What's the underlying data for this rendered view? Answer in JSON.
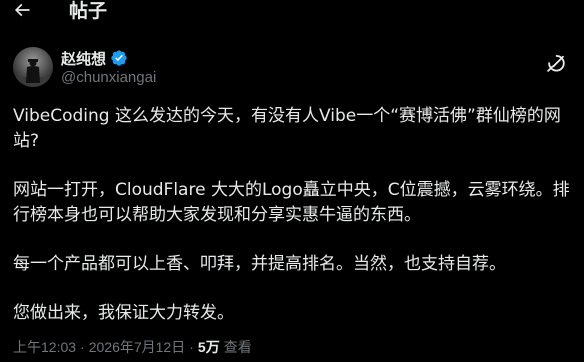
{
  "header": {
    "title": "帖子"
  },
  "author": {
    "display_name": "赵纯想",
    "handle": "@chunxiangai",
    "verified": true,
    "verified_color": "#1d9bf0"
  },
  "post": {
    "paragraphs": [
      "VibeCoding 这么发达的今天，有没有人Vibe一个“赛博活佛”群仙榜的网站?",
      "网站一打开，CloudFlare 大大的Logo矗立中央，C位震撼，云雾环绕。排行榜本身也可以帮助大家发现和分享实惠牛逼的东西。",
      "每一个产品都可以上香、叩拜，并提高排名。当然，也支持自荐。",
      "您做出来，我保证大力转发。"
    ]
  },
  "meta": {
    "time": "上午12:03",
    "separator": "·",
    "date": "2026年7月12日",
    "views_count": "5万",
    "views_label": "查看"
  },
  "icons": {
    "back": "arrow-left-icon",
    "verified": "verified-badge-icon",
    "grok": "grok-icon"
  }
}
